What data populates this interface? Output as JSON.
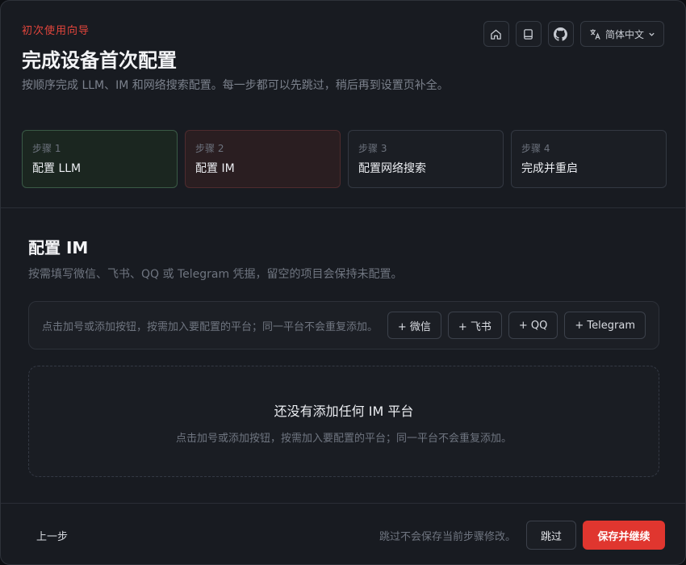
{
  "header": {
    "eyebrow": "初次使用向导",
    "title": "完成设备首次配置",
    "subtitle": "按顺序完成 LLM、IM 和网络搜索配置。每一步都可以先跳过，稍后再到设置页补全。",
    "language": "简体中文",
    "icons": [
      "home-icon",
      "book-icon",
      "github-icon",
      "translate-icon"
    ]
  },
  "steps": [
    {
      "num": "步骤 1",
      "name": "配置 LLM",
      "state": "done"
    },
    {
      "num": "步骤 2",
      "name": "配置 IM",
      "state": "active"
    },
    {
      "num": "步骤 3",
      "name": "配置网络搜索",
      "state": "pending"
    },
    {
      "num": "步骤 4",
      "name": "完成并重启",
      "state": "pending"
    }
  ],
  "section": {
    "title": "配置 IM",
    "description": "按需填写微信、飞书、QQ 或 Telegram 凭据，留空的项目会保持未配置。"
  },
  "add_bar": {
    "hint": "点击加号或添加按钮，按需加入要配置的平台；同一平台不会重复添加。",
    "buttons": [
      "+ 微信",
      "+ 飞书",
      "+ QQ",
      "+ Telegram"
    ]
  },
  "empty_state": {
    "title": "还没有添加任何 IM 平台",
    "description": "点击加号或添加按钮，按需加入要配置的平台；同一平台不会重复添加。"
  },
  "footer": {
    "prev_label": "上一步",
    "skip_note": "跳过不会保存当前步骤修改。",
    "skip_label": "跳过",
    "save_label": "保存并继续"
  },
  "colors": {
    "accent": "#e0362f",
    "done_step_bg": "#1b2620",
    "active_step_bg": "#2a1e21"
  }
}
